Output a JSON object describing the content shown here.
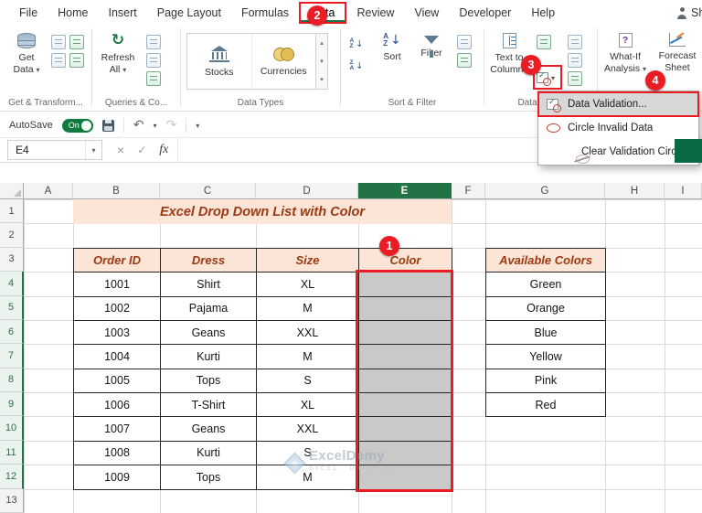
{
  "icons": {
    "dropdown_arrow": "▾",
    "gallery_up": "▴",
    "gallery_down": "▾",
    "undo": "↶",
    "redo": "↷",
    "refresh": "↻",
    "close": "×",
    "check": "✓",
    "down_arrow": "↓",
    "letter_a": "A",
    "letter_z": "Z",
    "question": "?"
  },
  "ribbon": {
    "tabs": [
      "File",
      "Home",
      "Insert",
      "Page Layout",
      "Formulas",
      "Data",
      "Review",
      "View",
      "Developer",
      "Help"
    ],
    "active_tab": "Data",
    "share_label": "Sh",
    "get_data": "Get Data",
    "refresh_all": "Refresh All",
    "stocks": "Stocks",
    "currencies": "Currencies",
    "sort": "Sort",
    "filter": "Filter",
    "text_to_columns": "Text to Columns",
    "what_if": "What-If Analysis",
    "forecast_sheet": "Forecast Sheet",
    "captions": {
      "get_transform": "Get & Transform...",
      "queries": "Queries & Co...",
      "data_types": "Data Types",
      "sort_filter": "Sort & Filter",
      "data_tools": "Data Tools"
    }
  },
  "qat": {
    "autosave_label": "AutoSave",
    "autosave_state": "On"
  },
  "formula_bar": {
    "name_box": "E4",
    "fx": "fx"
  },
  "menu": {
    "items": [
      {
        "label": "Data Validation...",
        "icon": "data-validation-icon"
      },
      {
        "label": "Circle Invalid Data",
        "icon": "circle-invalid-icon"
      },
      {
        "label": "Clear Validation Circles",
        "icon": "clear-circles-icon"
      }
    ]
  },
  "annotations": {
    "step1": "1",
    "step2": "2",
    "step3": "3",
    "step4": "4"
  },
  "sheet": {
    "columns": [
      "A",
      "B",
      "C",
      "D",
      "E",
      "F",
      "G",
      "H",
      "I"
    ],
    "rows": [
      "1",
      "2",
      "3",
      "4",
      "5",
      "6",
      "7",
      "8",
      "9",
      "10",
      "11",
      "12",
      "13"
    ],
    "selection": {
      "active_cell": "E4",
      "range": "E4:E12",
      "selected_column": "E",
      "selected_rows_start": 4,
      "selected_rows_end": 12
    },
    "title": "Excel Drop Down List with Color",
    "order_table": {
      "headers": [
        "Order ID",
        "Dress",
        "Size",
        "Color"
      ],
      "rows": [
        [
          "1001",
          "Shirt",
          "XL",
          ""
        ],
        [
          "1002",
          "Pajama",
          "M",
          ""
        ],
        [
          "1003",
          "Geans",
          "XXL",
          ""
        ],
        [
          "1004",
          "Kurti",
          "M",
          ""
        ],
        [
          "1005",
          "Tops",
          "S",
          ""
        ],
        [
          "1006",
          "T-Shirt",
          "XL",
          ""
        ],
        [
          "1007",
          "Geans",
          "XXL",
          ""
        ],
        [
          "1008",
          "Kurti",
          "S",
          ""
        ],
        [
          "1009",
          "Tops",
          "M",
          ""
        ]
      ]
    },
    "colors_table": {
      "header": "Available Colors",
      "values": [
        "Green",
        "Orange",
        "Blue",
        "Yellow",
        "Pink",
        "Red"
      ]
    }
  },
  "watermark": {
    "brand": "ExcelDemy",
    "tagline": "EXCEL · DATA · BI"
  },
  "colors": {
    "annotation_red": "#EC1C24",
    "excel_green": "#217346",
    "header_fill": "#FCE4D6",
    "header_text": "#9C3912",
    "selection_fill": "#C9C9C9"
  }
}
